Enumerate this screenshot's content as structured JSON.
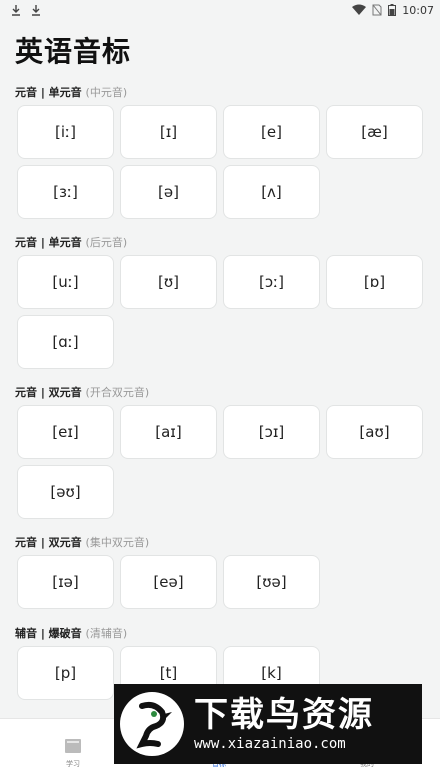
{
  "status": {
    "time": "10:07"
  },
  "title": "英语音标",
  "sections": [
    {
      "label": "元音 | 单元音",
      "sub": "(中元音)",
      "items": [
        "[iː]",
        "[ɪ]",
        "[e]",
        "[æ]",
        "[ɜː]",
        "[ə]",
        "[ʌ]"
      ]
    },
    {
      "label": "元音 | 单元音",
      "sub": "(后元音)",
      "items": [
        "[uː]",
        "[ʊ]",
        "[ɔː]",
        "[ɒ]",
        "[ɑː]"
      ]
    },
    {
      "label": "元音 | 双元音",
      "sub": "(开合双元音)",
      "items": [
        "[eɪ]",
        "[aɪ]",
        "[ɔɪ]",
        "[aʊ]",
        "[əʊ]"
      ]
    },
    {
      "label": "元音 | 双元音",
      "sub": "(集中双元音)",
      "items": [
        "[ɪə]",
        "[eə]",
        "[ʊə]"
      ]
    },
    {
      "label": "辅音 | 爆破音",
      "sub": "(清辅音)",
      "items": [
        "[p]",
        "[t]",
        "[k]"
      ]
    }
  ],
  "tabs": [
    {
      "label": "学习",
      "icon": "book-icon"
    },
    {
      "label": "音标",
      "icon": "phonetic-icon"
    },
    {
      "label": "我的",
      "icon": "profile-icon"
    }
  ],
  "watermark": {
    "title": "下载鸟资源",
    "url": "www.xiazainiao.com"
  }
}
